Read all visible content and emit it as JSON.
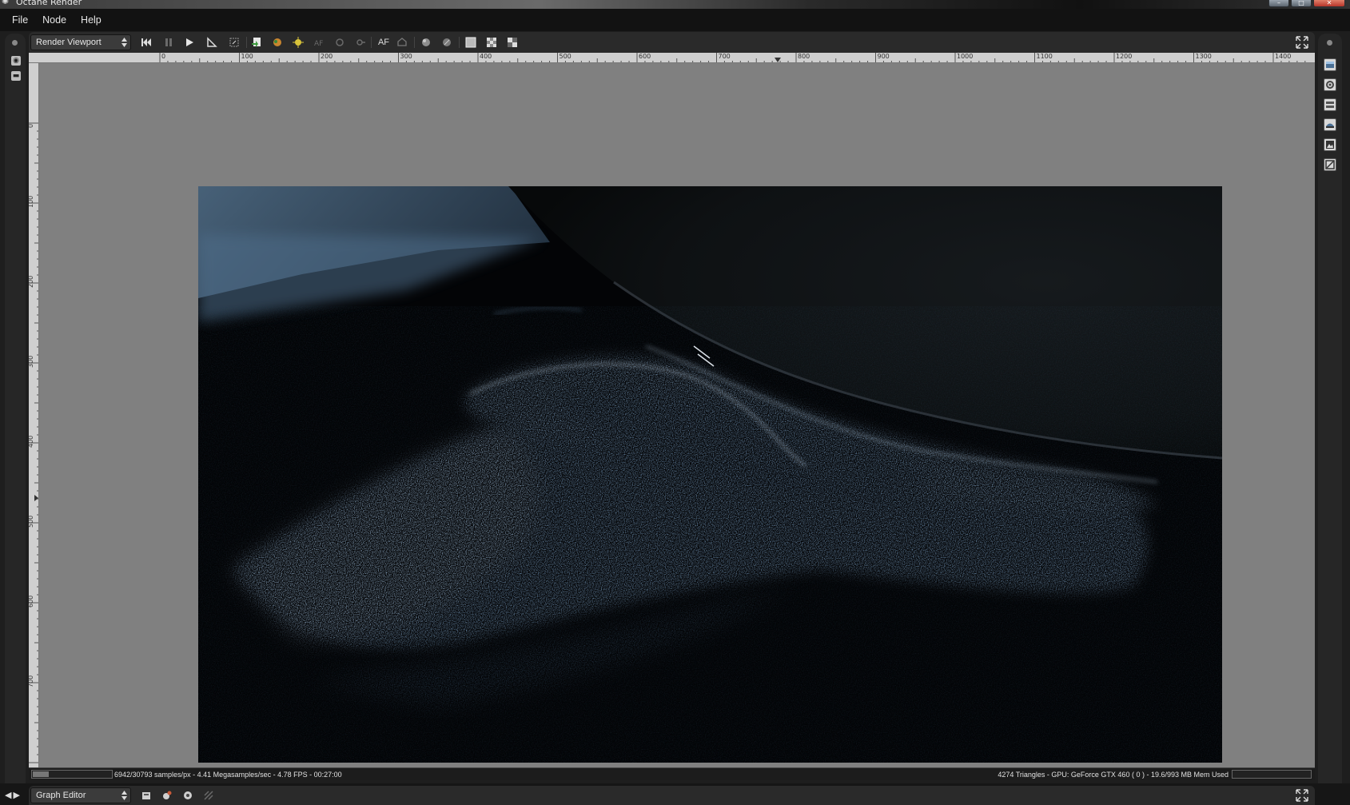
{
  "window": {
    "title": "Octane Render",
    "controls": [
      "minimize",
      "maximize",
      "close"
    ]
  },
  "menu": {
    "items": [
      "File",
      "Node",
      "Help"
    ]
  },
  "viewport_toolbar": {
    "selector_label": "Render Viewport",
    "af_label": "AF",
    "icons": [
      "skip-back-icon",
      "pause-icon",
      "play-icon",
      "region-icon",
      "zoom-region-icon",
      "save-render-icon",
      "color-picker-icon",
      "focus-picker-icon",
      "af-disabled-icon",
      "rotate-icon",
      "lock-icon",
      "af-icon",
      "camera-icon",
      "material-picker-icon",
      "object-picker-icon",
      "grid-icon",
      "checker-icon",
      "alpha-icon",
      "fullscreen-icon"
    ]
  },
  "ruler": {
    "top_labels": [
      "0",
      "100",
      "200",
      "300",
      "400",
      "500",
      "600",
      "700",
      "800",
      "900",
      "1000",
      "1100",
      "1200",
      "1300",
      "1400"
    ],
    "left_labels": [
      "0",
      "100",
      "200",
      "300",
      "400",
      "500",
      "600",
      "700"
    ]
  },
  "status": {
    "left": "6942/30793 samples/px - 4.41 Megasamples/sec - 4.78 FPS - 00:27:00",
    "right": "4274 Triangles - GPU: GeForce GTX 460 ( 0 ) - 19.6/993 MB Mem Used"
  },
  "graph_toolbar": {
    "selector_label": "Graph Editor",
    "icons": [
      "load-icon",
      "node-icon",
      "settings-icon",
      "disabled-tool-icon",
      "fullscreen-icon"
    ]
  },
  "right_panel": {
    "icons": [
      "render-icon",
      "camera-settings-icon",
      "layers-icon",
      "kernel-icon",
      "image-icon",
      "imager-icon"
    ]
  },
  "colors": {
    "accent_render": "#8fb4d8",
    "canvas_bg": "#808080"
  }
}
